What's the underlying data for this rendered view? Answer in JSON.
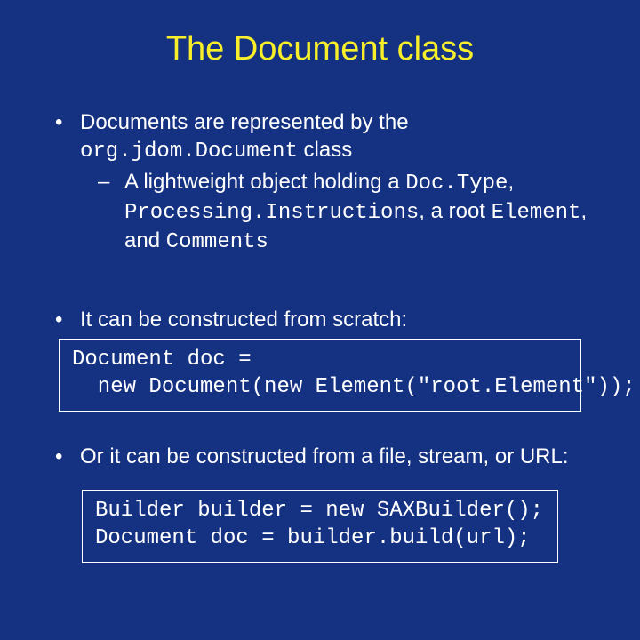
{
  "title": "The Document class",
  "bullets": {
    "b1_pre": "Documents are represented by the ",
    "b1_code": "org.jdom.Document",
    "b1_post": " class",
    "b1a_pre": "A lightweight object holding a ",
    "b1a_c1": "Doc.Type",
    "b1a_mid1": ", ",
    "b1a_c2": "Processing.Instructions",
    "b1a_mid2": ", a root ",
    "b1a_c3": "Element",
    "b1a_mid3": ", and ",
    "b1a_c4": "Comments",
    "b2": "It can be constructed from scratch:",
    "b3": "Or it can be constructed from a file, stream, or URL:"
  },
  "code1": "Document doc =\n  new Document(new Element(\"root.Element\"));",
  "code2": "Builder builder = new SAXBuilder();\nDocument doc = builder.build(url);"
}
